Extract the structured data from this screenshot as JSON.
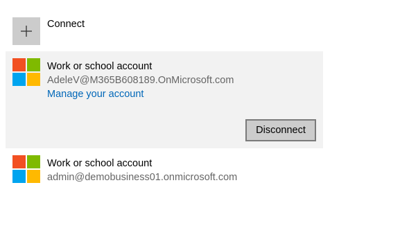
{
  "connect": {
    "label": "Connect",
    "icon": "plus-icon"
  },
  "accounts": [
    {
      "type_label": "Work or school account",
      "email": "AdeleV@M365B608189.OnMicrosoft.com",
      "manage_link": "Manage your account",
      "disconnect_label": "Disconnect",
      "icon": "microsoft-logo-icon",
      "selected": true
    },
    {
      "type_label": "Work or school account",
      "email": "admin@demobusiness01.onmicrosoft.com",
      "icon": "microsoft-logo-icon",
      "selected": false
    }
  ],
  "colors": {
    "link": "#0067b8",
    "selected_background": "#f2f2f2",
    "tile_background": "#cccccc",
    "logo_red": "#f25022",
    "logo_green": "#7fba00",
    "logo_blue": "#00a4ef",
    "logo_yellow": "#ffb900"
  }
}
